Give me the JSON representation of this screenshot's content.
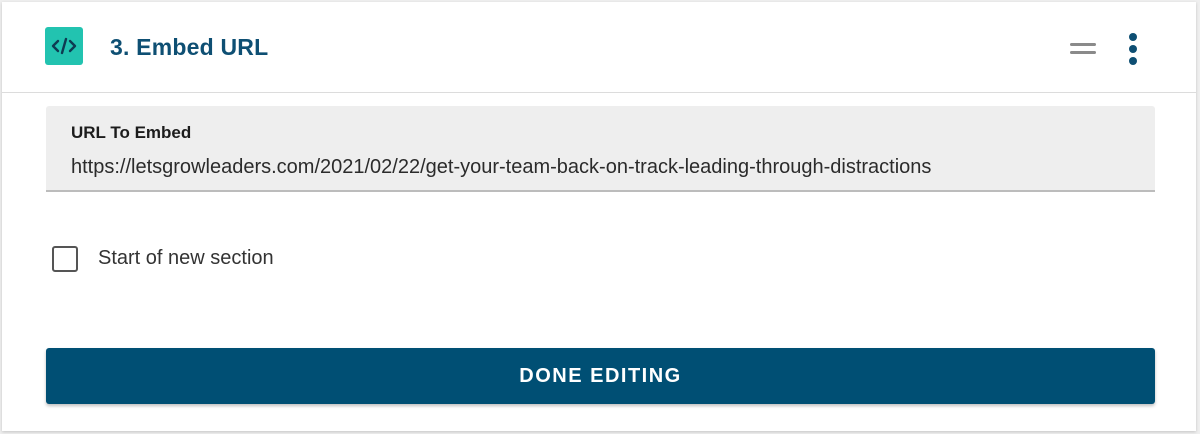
{
  "block": {
    "title": "3. Embed URL",
    "icon": "code-icon",
    "icon_color": "#22c3b0",
    "title_color": "#0e4f73"
  },
  "header_actions": {
    "drag_icon": "drag-handle-icon",
    "menu_icon": "more-vertical-icon"
  },
  "url_field": {
    "label": "URL To Embed",
    "value": "https://letsgrowleaders.com/2021/02/22/get-your-team-back-on-track-leading-through-distractions"
  },
  "section_checkbox": {
    "label": "Start of new section",
    "checked": false
  },
  "done_button": {
    "label": "DONE EDITING",
    "color": "#004f74"
  }
}
